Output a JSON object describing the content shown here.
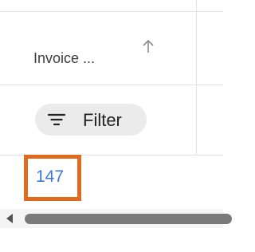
{
  "column": {
    "header_label": "Invoice ...",
    "sort_icon": "arrow-up-icon",
    "filter_label": "Filter",
    "filter_icon": "filter-lines-icon"
  },
  "cells": [
    {
      "value": "147"
    }
  ],
  "colors": {
    "selected_border": "#e06a1f",
    "link": "#3b78d8",
    "chip_bg": "#ebebeb"
  }
}
